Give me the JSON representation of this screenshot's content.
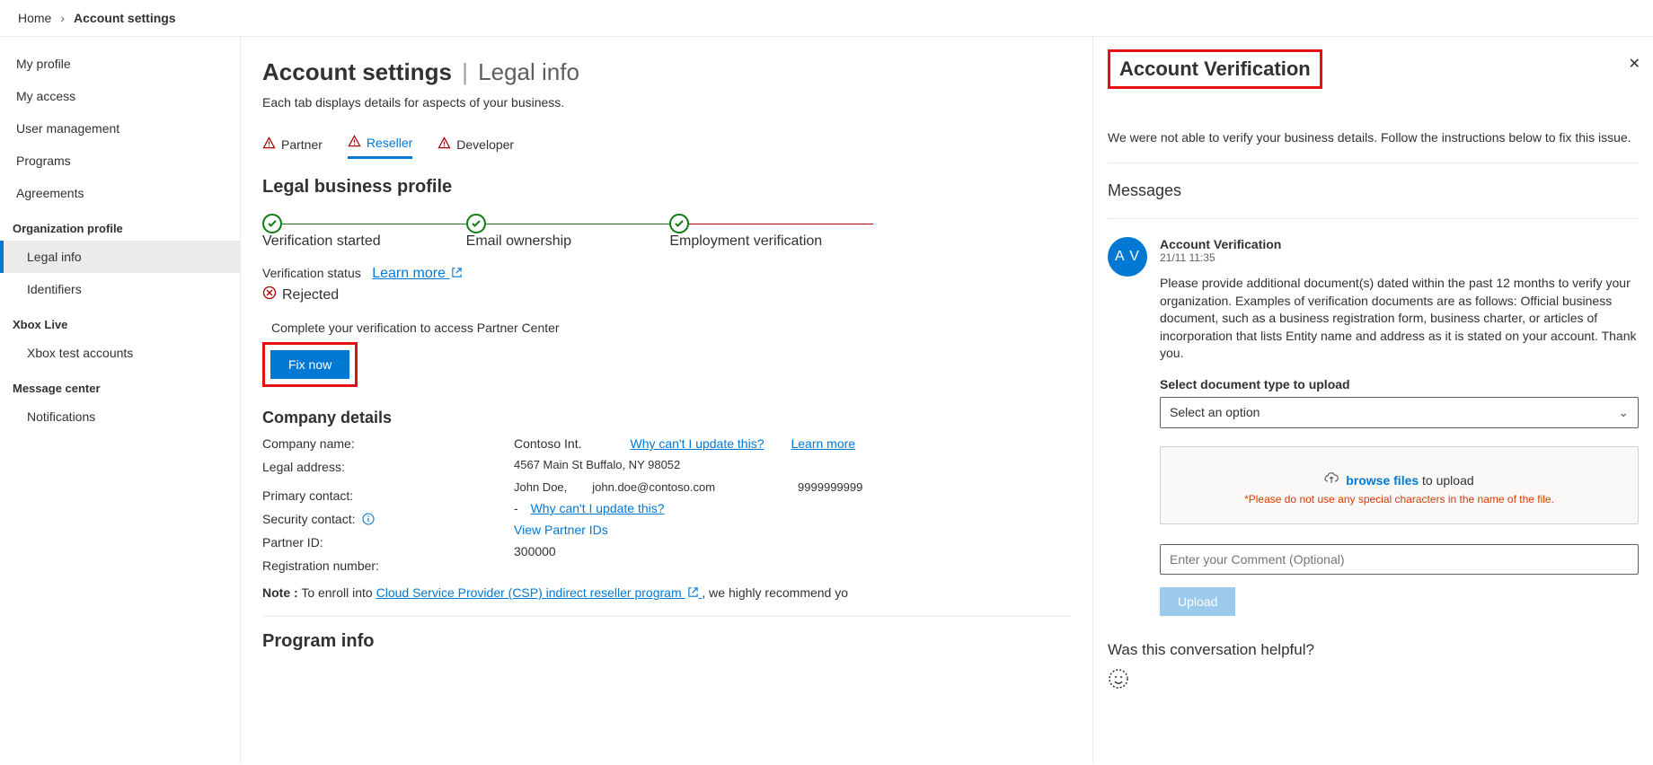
{
  "breadcrumb": {
    "home": "Home",
    "current": "Account settings"
  },
  "sidebar": {
    "items": [
      "My profile",
      "My access",
      "User management",
      "Programs",
      "Agreements"
    ],
    "orgGroup": {
      "title": "Organization profile",
      "items": [
        "Legal info",
        "Identifiers"
      ]
    },
    "xboxGroup": {
      "title": "Xbox Live",
      "items": [
        "Xbox test accounts"
      ]
    },
    "msgGroup": {
      "title": "Message center",
      "items": [
        "Notifications"
      ]
    }
  },
  "main": {
    "title": "Account settings",
    "subtitle": "Legal info",
    "desc": "Each tab displays details for aspects of your business.",
    "tabs": [
      "Partner",
      "Reseller",
      "Developer"
    ],
    "legalTitle": "Legal business profile",
    "steps": [
      "Verification started",
      "Email ownership",
      "Employment verification"
    ],
    "vstatusLabel": "Verification status",
    "learnMore": "Learn more",
    "rejected": "Rejected",
    "instruction": "Complete your verification to access Partner Center",
    "fixNow": "Fix now",
    "companyTitle": "Company details",
    "labels": {
      "companyName": "Company name:",
      "legalAddress": "Legal address:",
      "primaryContact": "Primary contact:",
      "securityContact": "Security contact:",
      "partnerId": "Partner ID:",
      "regNum": "Registration number:"
    },
    "values": {
      "companyName": "Contoso Int.",
      "legalAddress": "4567 Main St Buffalo, NY 98052",
      "primaryContactName": "John Doe,",
      "primaryContactEmail": "john.doe@contoso.com",
      "primaryContactPhone": "9999999999",
      "securityContact": "-",
      "partnerId": "View Partner IDs",
      "regNum": "300000"
    },
    "whyCant": "Why can't I update this?",
    "learnMore2": "Learn more",
    "noteLabel": "Note :",
    "noteText": "To enroll into ",
    "noteLink": "Cloud Service Provider (CSP) indirect reseller program",
    "noteTail": " , we highly recommend yo",
    "programTitle": "Program info"
  },
  "panel": {
    "title": "Account Verification",
    "desc": "We were not able to verify your business details. Follow the instructions below to fix this issue.",
    "messagesTitle": "Messages",
    "avatar": "A V",
    "msgTitle": "Account Verification",
    "msgTime": "21/11 11:35",
    "msgText": "Please provide additional document(s) dated within the past 12 months to verify your organization. Examples of verification documents are as follows: Official business document, such as a business registration form, business charter, or articles of incorporation that lists Entity name and address as it is stated on your account. Thank you.",
    "selectLabel": "Select document type to upload",
    "selectPlaceholder": "Select an option",
    "browse": "browse files",
    "toUpload": " to upload",
    "dzNote": "Please do not use any special characters in the name of the file.",
    "commentPlaceholder": "Enter your Comment (Optional)",
    "upload": "Upload",
    "helpful": "Was this conversation helpful?"
  }
}
